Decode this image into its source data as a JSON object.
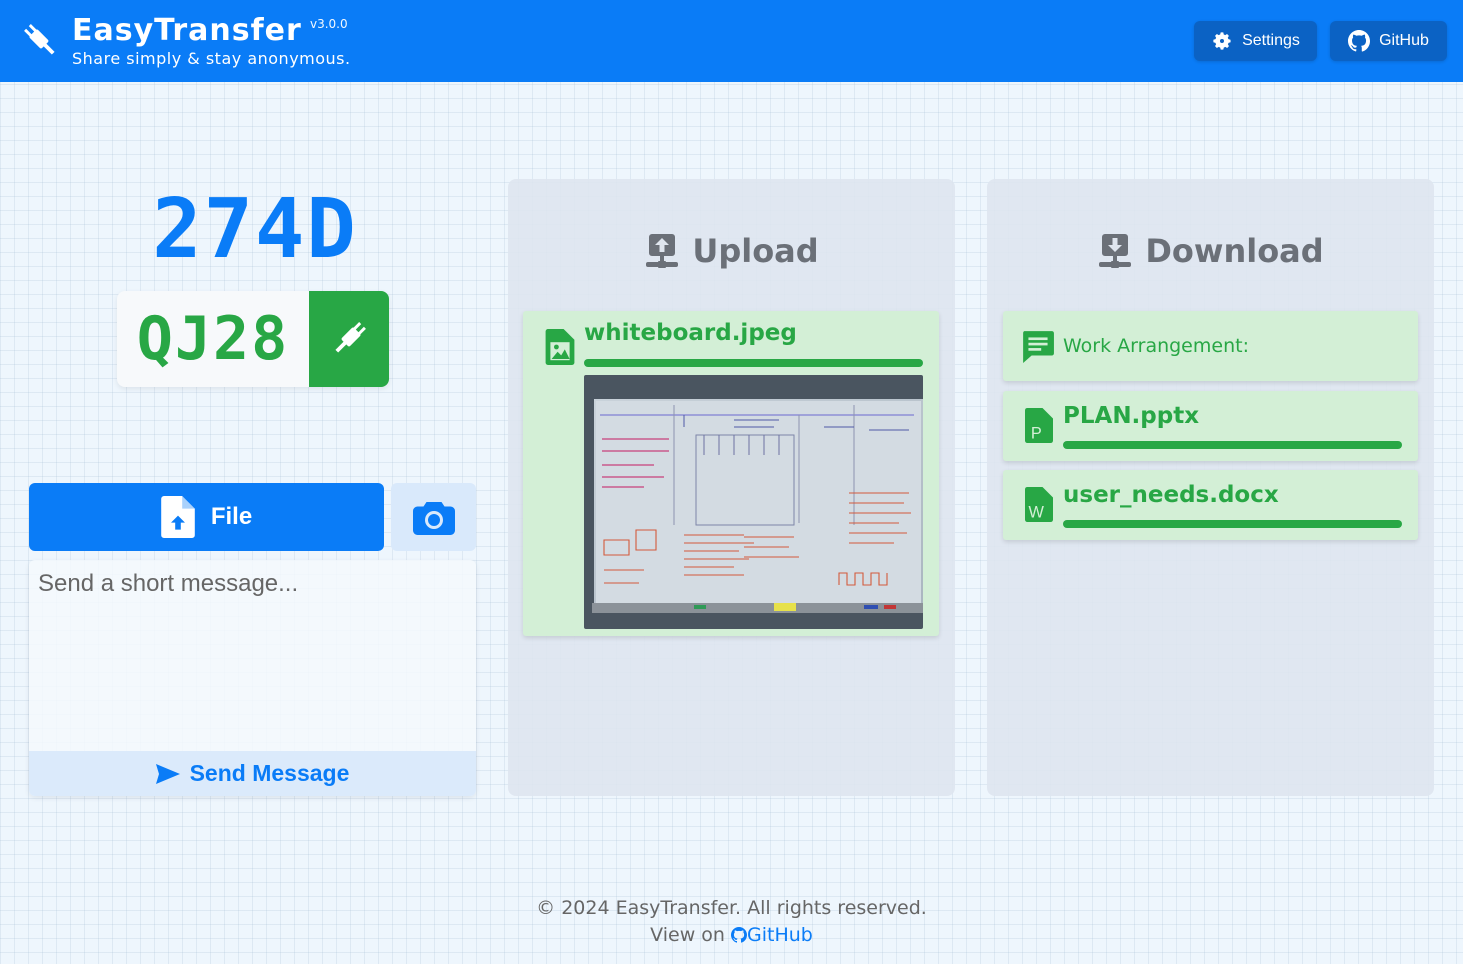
{
  "header": {
    "brand": "EasyTransfer",
    "version": "v3.0.0",
    "tagline": "Share simply & stay anonymous.",
    "settings_label": "Settings",
    "github_label": "GitHub",
    "background_color": "#0a7cf7"
  },
  "codes": {
    "main_code": "274D",
    "peer_code": "QJ28"
  },
  "actions": {
    "file_label": "File",
    "message_placeholder": "Send a short message...",
    "send_label": "Send Message"
  },
  "upload": {
    "title": "Upload",
    "items": [
      {
        "name": "whiteboard.jpeg",
        "type": "image",
        "icon": "file-image-icon",
        "progress": 1.0
      }
    ]
  },
  "download": {
    "title": "Download",
    "message": {
      "text": "Work Arrangement:",
      "icon": "message-icon"
    },
    "items": [
      {
        "name": "PLAN.pptx",
        "icon": "file-powerpoint-icon",
        "progress": 1.0
      },
      {
        "name": "user_needs.docx",
        "icon": "file-word-icon",
        "progress": 1.0
      }
    ]
  },
  "footer": {
    "copyright": "© 2024 EasyTransfer. All rights reserved.",
    "view_on": "View on",
    "github_link": "GitHub"
  },
  "colors": {
    "primary": "#0a7cf7",
    "success": "#28a745",
    "card_bg": "#d3efd6"
  }
}
